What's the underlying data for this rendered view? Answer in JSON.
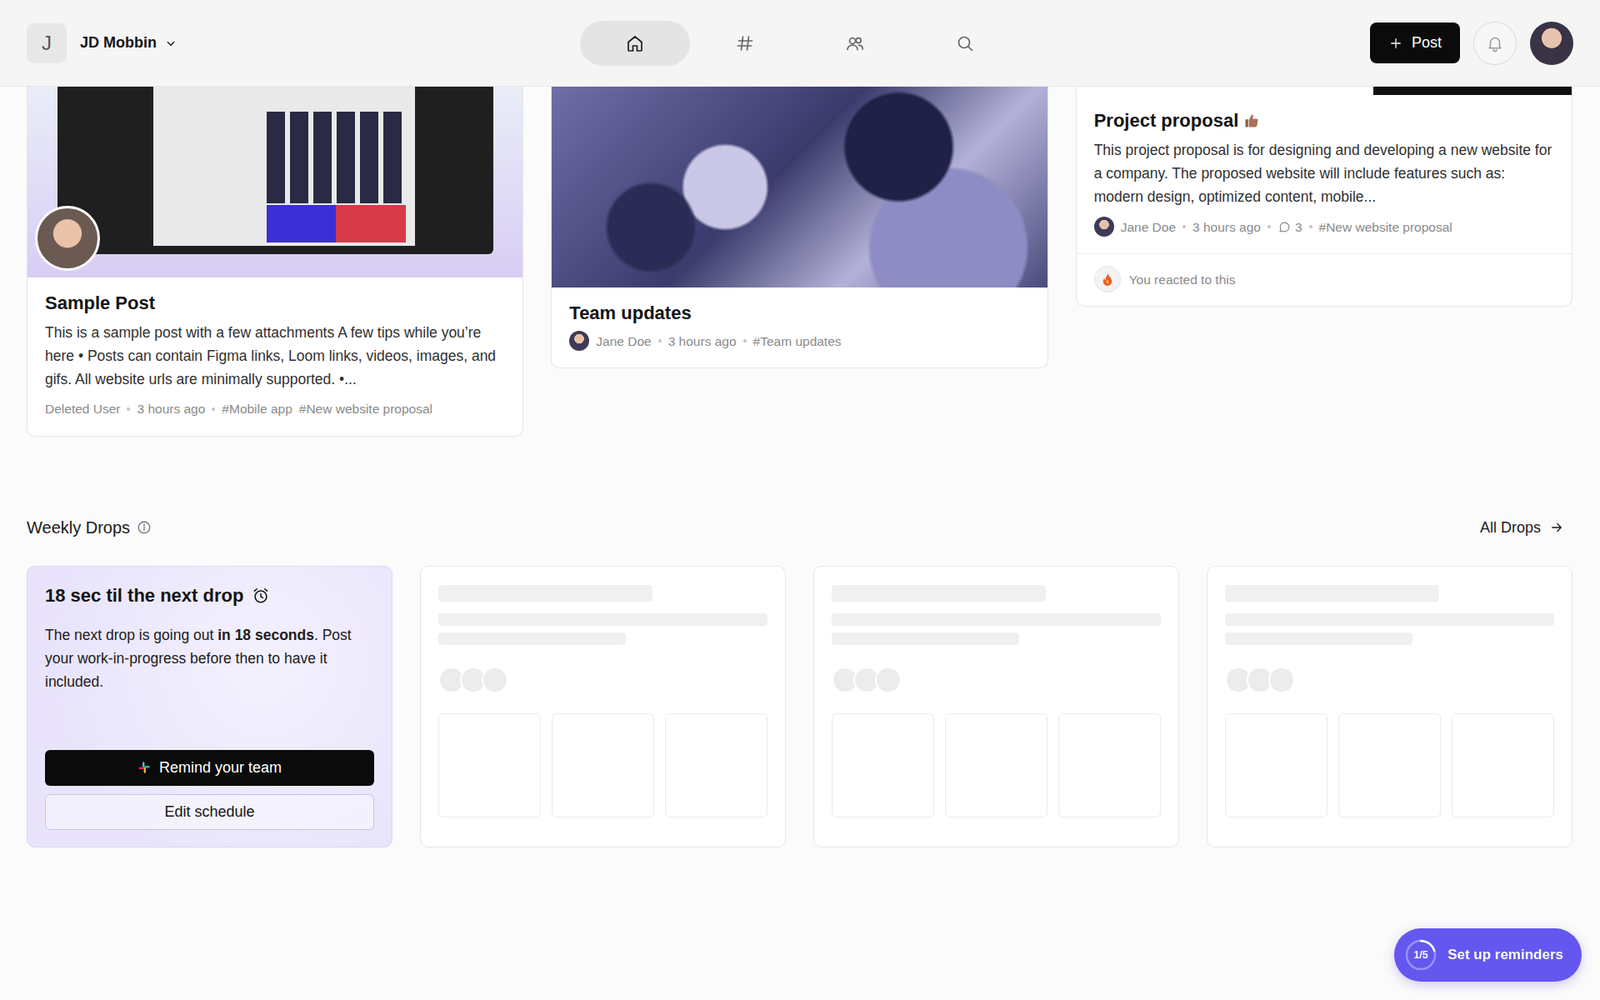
{
  "workspace": {
    "initial": "J",
    "name": "JD Mobbin"
  },
  "nav": [
    {
      "kind": "home",
      "selected": true
    },
    {
      "kind": "channels",
      "selected": false
    },
    {
      "kind": "people",
      "selected": false
    },
    {
      "kind": "search",
      "selected": false
    }
  ],
  "post_button": "Post",
  "posts": [
    {
      "kind": "screenshot",
      "cover_avatar": true,
      "title": "Sample Post",
      "excerpt": "This is a sample post with a few attachments A few tips while you’re here • Posts can contain Figma links, Loom links, videos, images, and gifs. All website urls are minimally supported. •...",
      "author": "Deleted User",
      "time": "3 hours ago",
      "tags": [
        "#Mobile app",
        "#New website proposal"
      ]
    },
    {
      "kind": "photo",
      "title": "Team updates",
      "author_avatar": true,
      "author": "Jane Doe",
      "time": "3 hours ago",
      "tags": [
        "#Team updates"
      ]
    },
    {
      "kind": "video",
      "title": "Project proposal",
      "title_badge": true,
      "excerpt": "This project proposal is for designing and developing a new website for a company. The proposed website will include features such as: modern design, optimized content, mobile...",
      "author_avatar": true,
      "author": "Jane Doe",
      "time": "3 hours ago",
      "comments": "3",
      "tags": [
        "#New website proposal"
      ],
      "reaction": {
        "text": "You reacted to this",
        "reacted": true
      }
    }
  ],
  "drops": {
    "title": "Weekly Drops",
    "all_link": "All Drops",
    "next": {
      "title": "18 sec til the next drop",
      "text_before": "The next drop is going out ",
      "text_bold": "in 18 seconds",
      "text_after": ". Post your work-in-progress before then to have it included.",
      "primary": "Remind your team",
      "secondary": "Edit schedule"
    },
    "cards": [
      {
        "loading": true
      },
      {
        "loading": true
      },
      {
        "loading": true
      }
    ]
  },
  "onboarding": {
    "progress": "1/5",
    "level": 0.2,
    "label": "Set up reminders"
  }
}
